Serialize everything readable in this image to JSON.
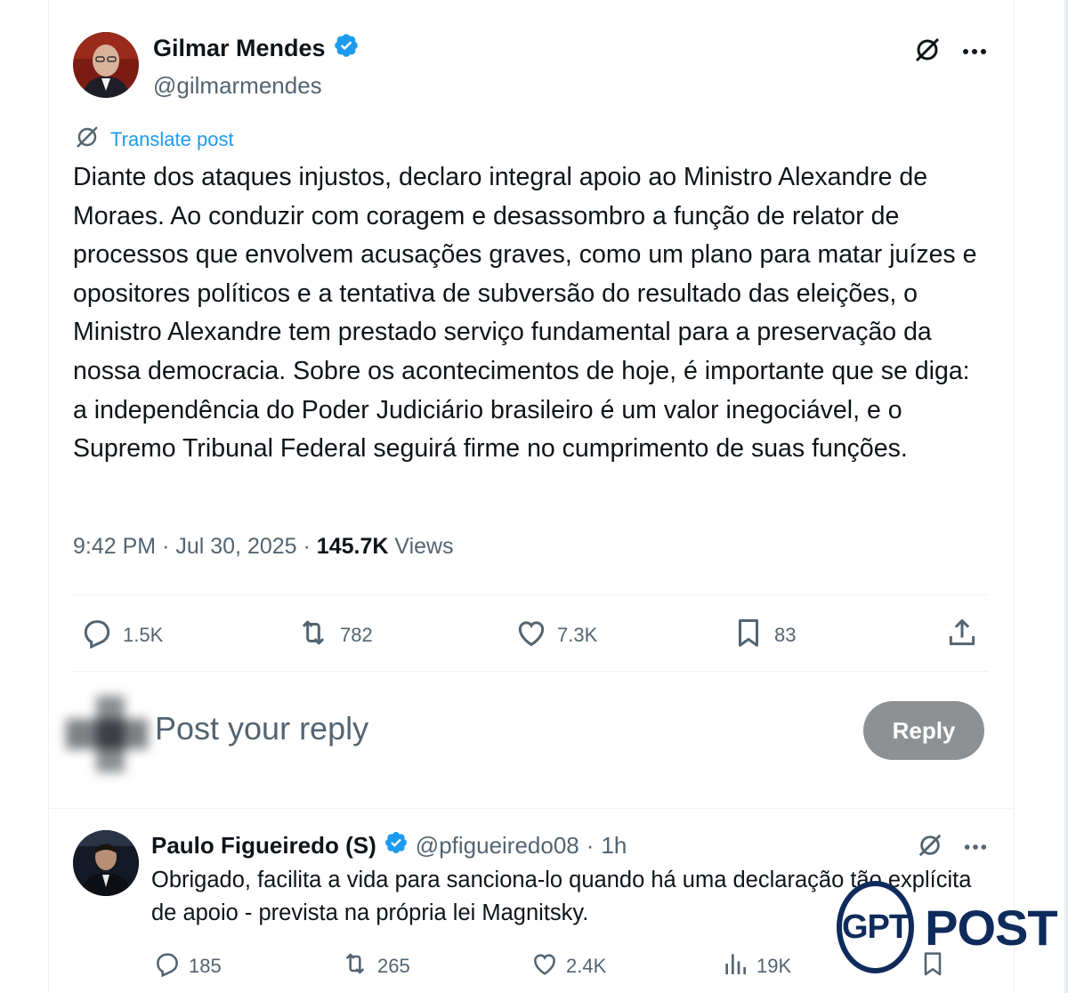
{
  "post": {
    "author_name": "Gilmar Mendes",
    "author_handle": "@gilmarmendes",
    "translate_label": "Translate post",
    "text": "Diante dos ataques injustos, declaro integral apoio ao Ministro Alexandre de Moraes. Ao conduzir com coragem e desassombro a função de relator de processos que envolvem acusações graves, como um plano para matar juízes e opositores políticos e a tentativa de subversão do resultado das eleições, o Ministro Alexandre tem prestado serviço fundamental para a preservação da nossa democracia. Sobre os acontecimentos de hoje, é importante que se diga: a independência do Poder Judiciário brasileiro é um valor inegociável, e o Supremo Tribunal Federal seguirá firme no cumprimento de suas funções.",
    "time": "9:42 PM",
    "date": "Jul 30, 2025",
    "views_count": "145.7K",
    "views_label": "Views",
    "stats": {
      "replies": "1.5K",
      "reposts": "782",
      "likes": "7.3K",
      "bookmarks": "83"
    }
  },
  "reply_box": {
    "placeholder": "Post your reply",
    "button_label": "Reply"
  },
  "comment": {
    "author_name": "Paulo Figueiredo (S)",
    "author_handle": "@pfigueiredo08",
    "time_ago": "1h",
    "text": "Obrigado, facilita a vida para sanciona-lo quando há uma declaração tão explícita de apoio - prevista na própria lei Magnitsky.",
    "stats": {
      "replies": "185",
      "reposts": "265",
      "likes": "2.4K",
      "views": "19K"
    }
  },
  "watermark": {
    "left": "GPT",
    "right": "POST"
  },
  "colors": {
    "accent": "#1d9bf0",
    "text": "#0f1419",
    "secondary": "#536471",
    "reply_button": "#8e9193",
    "watermark": "#0f2b5c"
  }
}
